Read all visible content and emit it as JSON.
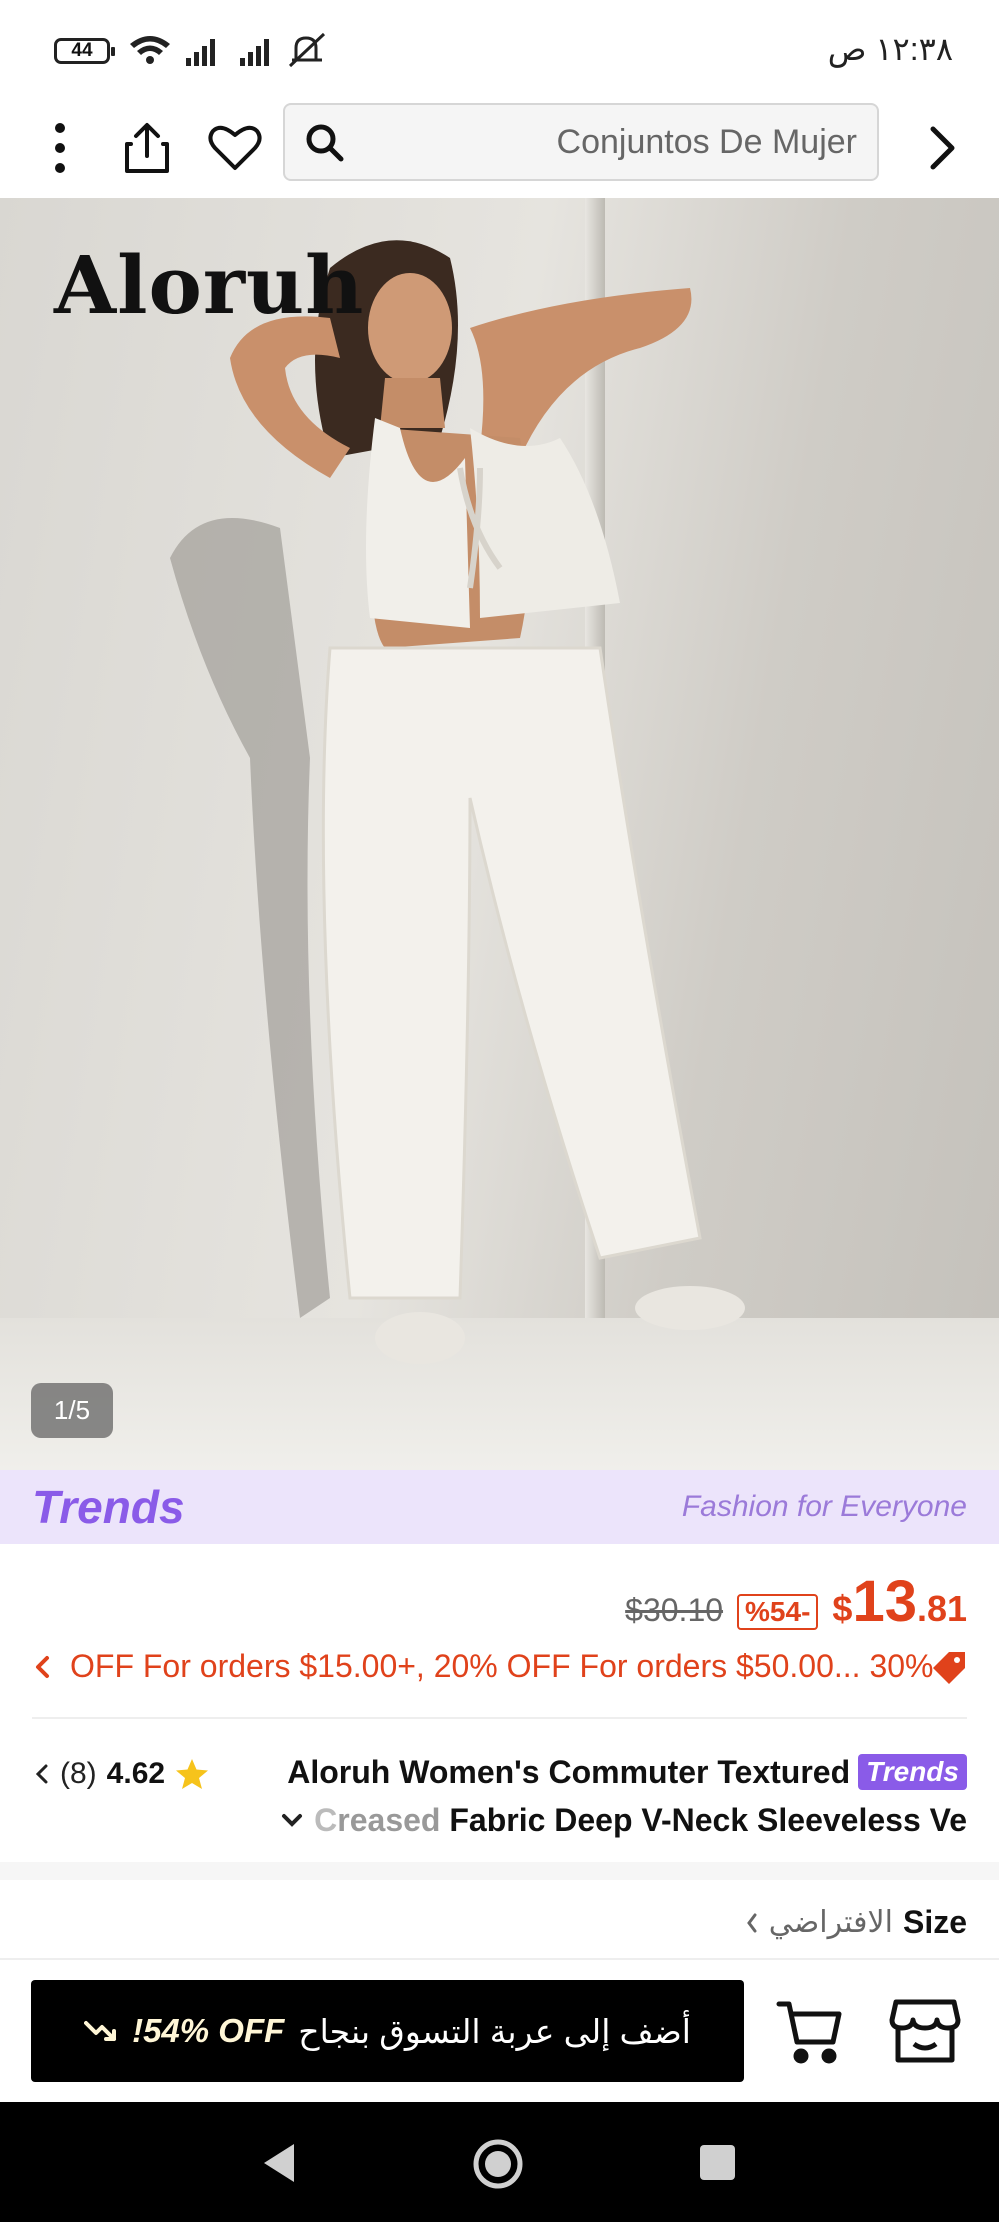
{
  "status_bar": {
    "battery": "44",
    "time": "١٢:٣٨ ص"
  },
  "top_nav": {
    "search_text": "Conjuntos De Mujer",
    "icons": [
      "more-vert-icon",
      "share-icon",
      "heart-icon",
      "search-icon",
      "chevron-right-icon"
    ]
  },
  "hero": {
    "brand_logo": "Aloruh",
    "image_counter": "1/5"
  },
  "trends_banner": {
    "logo": "Trends",
    "slogan": "Fashion for Everyone"
  },
  "price": {
    "original": "$30.10",
    "discount": "%54-",
    "currency": "$",
    "main": "13",
    "cents": ".81",
    "accent_color": "#e0421b"
  },
  "promo": {
    "text": "OFF For orders $15.00+,  20% OFF For orders $50.00... 30%"
  },
  "product": {
    "rating_count": "(8)",
    "rating_score": "4.62",
    "title_line1": "Aloruh Women's Commuter Textured",
    "title_tag": "Trends",
    "title_line2_fade": "C",
    "title_line2_faded": "reased",
    "title_line2": "Fabric Deep V-Neck Sleeveless Ve"
  },
  "size": {
    "label": "Size",
    "default": "الافتراضي"
  },
  "action_bar": {
    "add_to_cart": "أضف إلى عربة التسوق بنجاح",
    "off_text": "!54% OFF"
  }
}
